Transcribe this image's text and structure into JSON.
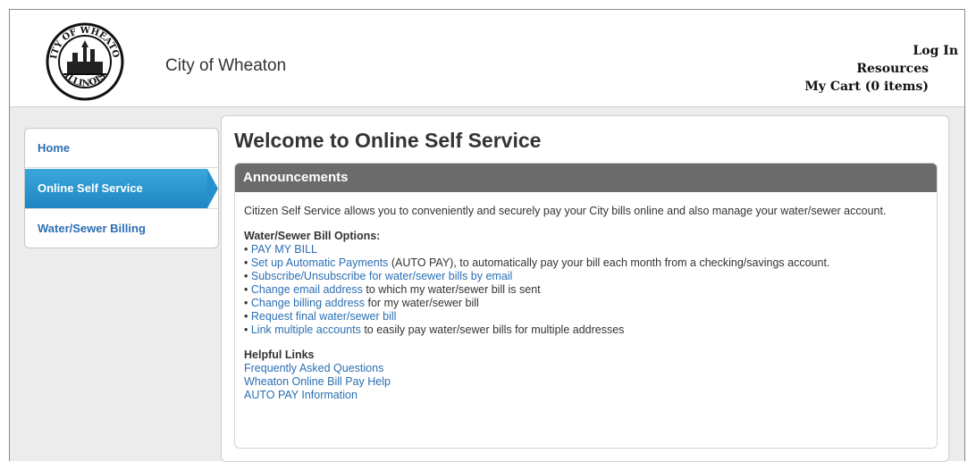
{
  "header": {
    "site_name": "City of Wheaton",
    "links": {
      "login": "Log In",
      "resources": "Resources",
      "cart": "My Cart (0 items)"
    },
    "seal_text": "CITY OF WHEATON ILLINOIS"
  },
  "sidebar": {
    "items": [
      {
        "label": "Home"
      },
      {
        "label": "Online Self Service"
      },
      {
        "label": "Water/Sewer Billing"
      }
    ]
  },
  "main": {
    "title": "Welcome to Online Self Service",
    "panel": {
      "heading": "Announcements",
      "intro": "Citizen Self Service allows you to conveniently and securely pay your City bills online and also manage your water/sewer account.",
      "options_title": "Water/Sewer Bill Options:",
      "options": [
        {
          "link": "PAY MY BILL",
          "rest": ""
        },
        {
          "link": "Set up Automatic Payments",
          "rest": " (AUTO PAY), to automatically pay your bill each month from a checking/savings account."
        },
        {
          "link": "Subscribe/Unsubscribe for water/sewer bills by email",
          "rest": ""
        },
        {
          "link": "Change email address",
          "rest": " to which my water/sewer bill is sent"
        },
        {
          "link": "Change billing address",
          "rest": " for my water/sewer bill"
        },
        {
          "link": "Request final water/sewer bill",
          "rest": ""
        },
        {
          "link": "Link multiple accounts",
          "rest": " to easily pay water/sewer bills for multiple addresses"
        }
      ],
      "helpful_title": "Helpful Links",
      "helpful_links": [
        "Frequently Asked Questions",
        "Wheaton Online Bill Pay Help",
        "AUTO PAY Information"
      ]
    }
  },
  "colors": {
    "link": "#2b6fb3",
    "active_nav": "#2590cc",
    "panel_header": "#6b6b6b"
  }
}
